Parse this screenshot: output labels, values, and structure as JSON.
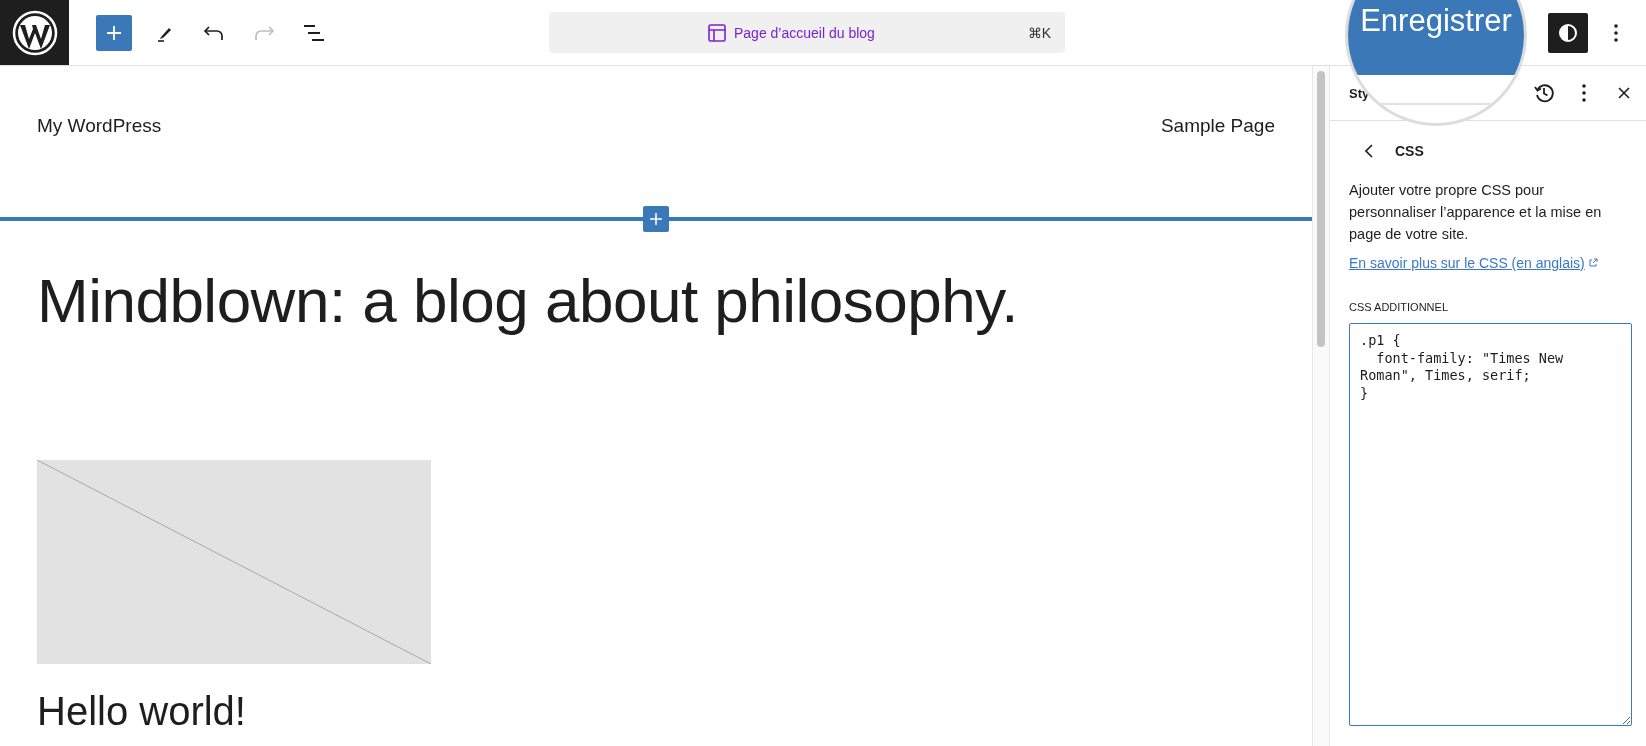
{
  "toolbar": {
    "tools": [
      {
        "kind": "add",
        "disabled": false
      },
      {
        "kind": "pen",
        "disabled": false
      },
      {
        "kind": "undo",
        "disabled": false
      },
      {
        "kind": "redo",
        "disabled": true
      },
      {
        "kind": "outline",
        "disabled": false
      }
    ],
    "command_bar": {
      "title": "Page d’accueil du blog",
      "shortcut": "⌘K"
    },
    "save_button": {
      "label": "Enregistrer"
    }
  },
  "canvas": {
    "site_title": "My WordPress",
    "nav_items": [
      "Sample Page"
    ],
    "heading": "Mindblown: a blog about philosophy.",
    "post_title": "Hello world!"
  },
  "sidebar": {
    "title": "Sty",
    "section_title": "CSS",
    "description": "Ajouter votre propre CSS pour personnaliser l’apparence et la mise en page de votre site.",
    "link": "En savoir plus sur le CSS (en anglais)",
    "field_label": "CSS ADDITIONNEL",
    "css_value": ".p1 {\n  font-family: \"Times New Roman\", Times, serif;\n}"
  }
}
